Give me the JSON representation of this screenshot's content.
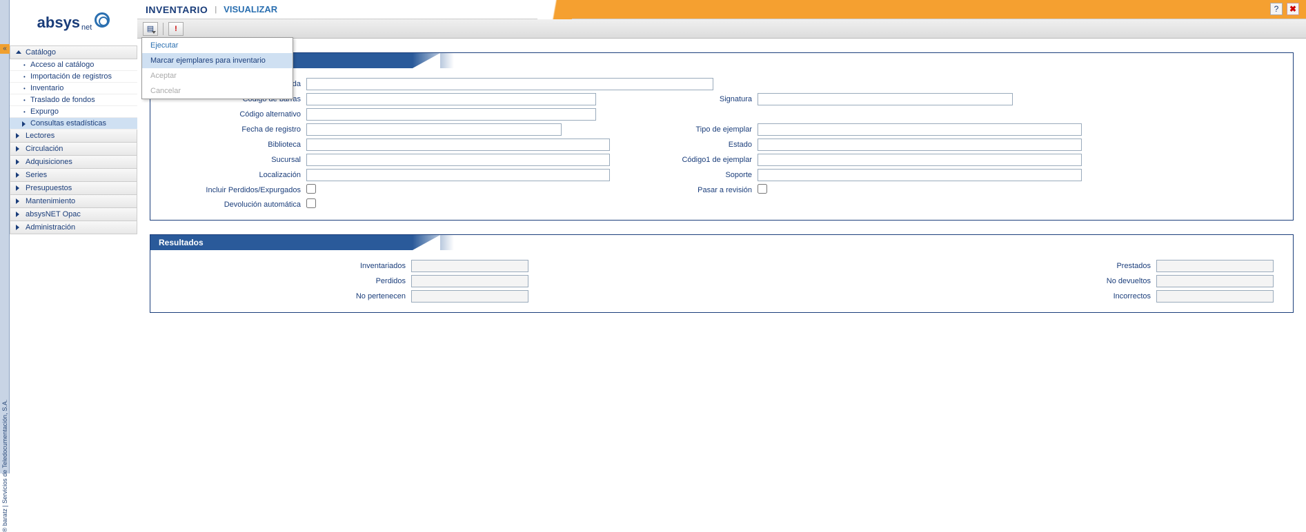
{
  "copyright": "® baratz | Servicios de Teledocumentación, S.A.",
  "logo": {
    "main": "absys",
    "sub": "net"
  },
  "header": {
    "title": "INVENTARIO",
    "subtitle": "VISUALIZAR"
  },
  "nav": {
    "catalogo": {
      "label": "Catálogo",
      "items": [
        "Acceso al catálogo",
        "Importación de registros",
        "Inventario",
        "Traslado de fondos",
        "Expurgo",
        "Consultas estadísticas"
      ]
    },
    "others": [
      "Lectores",
      "Circulación",
      "Adquisiciones",
      "Series",
      "Presupuestos",
      "Mantenimiento",
      "absysNET Opac",
      "Administración"
    ]
  },
  "dropdown": {
    "ejecutar": "Ejecutar",
    "marcar": "Marcar ejemplares para inventario",
    "aceptar": "Aceptar",
    "cancelar": "Cancelar"
  },
  "form": {
    "labels": {
      "fichero": "Fichero de salida",
      "codigo_barras": "Código de barras",
      "codigo_alt": "Código alternativo",
      "fecha_reg": "Fecha de registro",
      "biblioteca": "Biblioteca",
      "sucursal": "Sucursal",
      "localizacion": "Localización",
      "incluir": "Incluir Perdidos/Expurgados",
      "devolucion": "Devolución automática",
      "signatura": "Signatura",
      "tipo_ejemplar": "Tipo de ejemplar",
      "estado": "Estado",
      "codigo1": "Código1 de ejemplar",
      "soporte": "Soporte",
      "pasar": "Pasar a revisión"
    }
  },
  "results": {
    "title": "Resultados",
    "labels": {
      "inventariados": "Inventariados",
      "perdidos": "Perdidos",
      "no_pertenecen": "No pertenecen",
      "prestados": "Prestados",
      "no_devueltos": "No devueltos",
      "incorrectos": "Incorrectos"
    }
  }
}
